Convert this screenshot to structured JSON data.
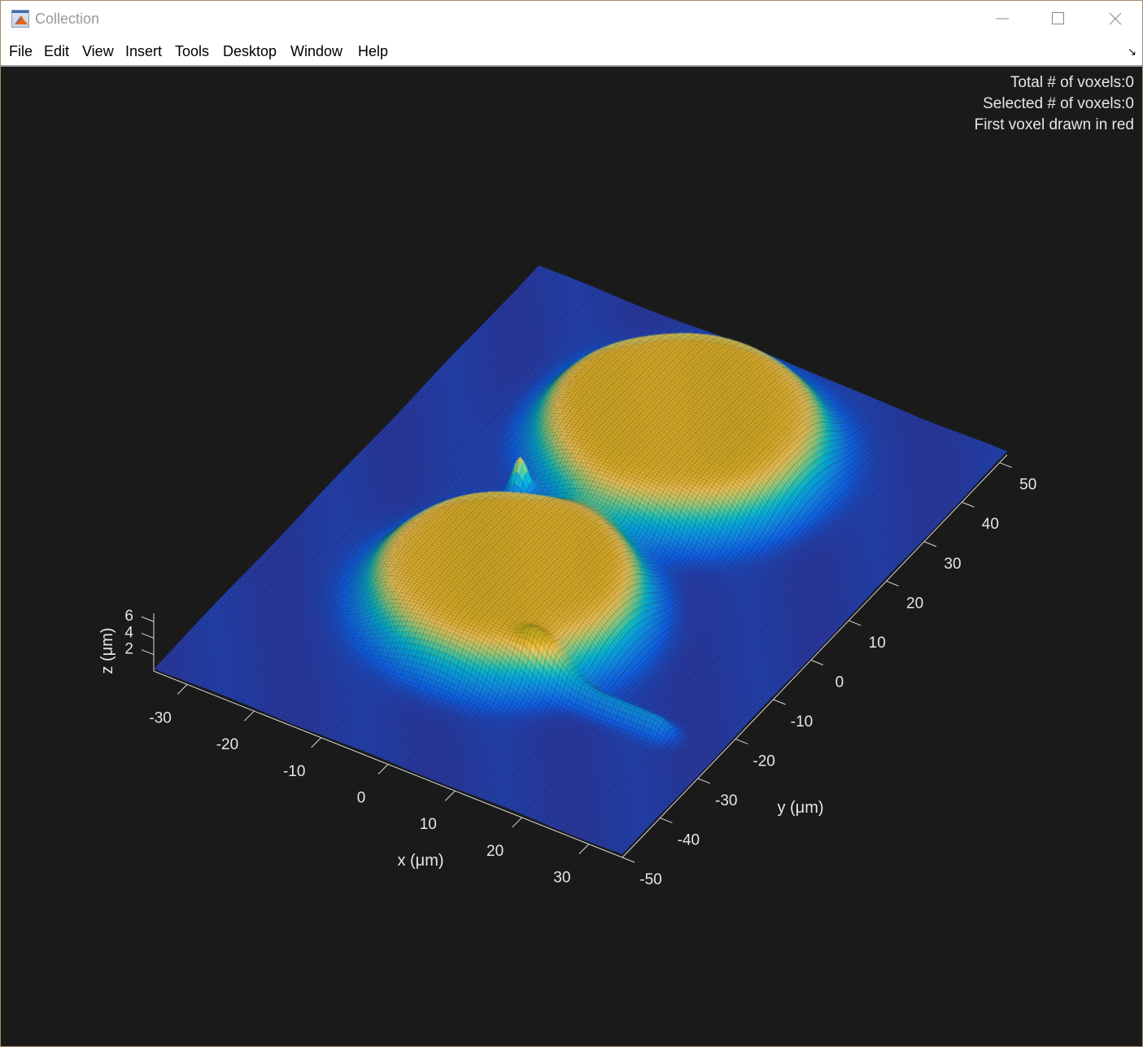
{
  "window": {
    "title": "Collection",
    "controls": {
      "minimize": "minimize",
      "maximize": "maximize",
      "close": "close"
    }
  },
  "menubar": {
    "items": [
      "File",
      "Edit",
      "View",
      "Insert",
      "Tools",
      "Desktop",
      "Window",
      "Help"
    ],
    "dock_icon": "↘"
  },
  "figure": {
    "info_lines": [
      "Total # of voxels:0",
      "Selected # of voxels:0",
      "First voxel drawn in red"
    ],
    "background": "#1a1a1a",
    "axis_color": "#d9d9d9"
  },
  "chart_data": {
    "type": "surface",
    "title": "",
    "xlabel": "x (μm)",
    "ylabel": "y (μm)",
    "zlabel": "z (μm)",
    "xlim": [
      -35,
      35
    ],
    "ylim": [
      -50,
      52
    ],
    "zlim": [
      0,
      7
    ],
    "xticks": [
      -30,
      -20,
      -10,
      0,
      10,
      20,
      30
    ],
    "yticks": [
      -50,
      -40,
      -30,
      -20,
      -10,
      0,
      10,
      20,
      30,
      40,
      50
    ],
    "zticks": [
      2,
      4,
      6
    ],
    "colormap": "parula",
    "grid": false,
    "features": [
      {
        "name": "mound-1",
        "x_center": 0,
        "y_center": 28,
        "radius": 19,
        "height": 5.5
      },
      {
        "name": "mound-2",
        "x_center": -3,
        "y_center": -13,
        "radius": 18,
        "height": 5.5
      },
      {
        "name": "bridge-spike",
        "x_center": -13,
        "y_center": 8,
        "height": 4.5
      },
      {
        "name": "tail-ridge",
        "x_center": 20,
        "y_center": -25,
        "height": 1.8
      }
    ]
  }
}
